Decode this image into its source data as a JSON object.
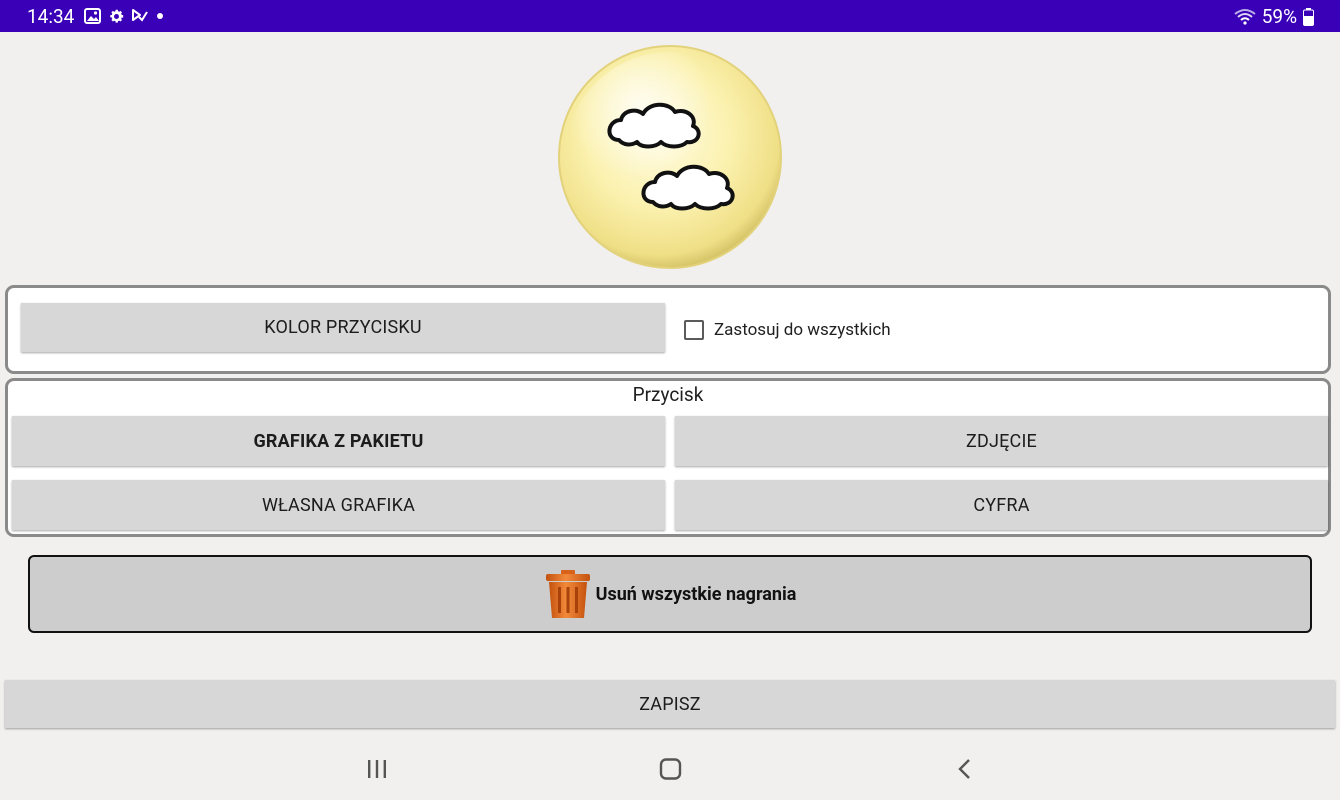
{
  "status_bar": {
    "time": "14:34",
    "battery_percent": "59%",
    "left_icons": [
      "image-icon",
      "gear-icon",
      "download-check-icon",
      "dot-icon"
    ],
    "right_icons": [
      "wifi-icon",
      "battery-icon"
    ],
    "background_color": "#3a00b8"
  },
  "preview": {
    "icon": "sun-cloud-icon"
  },
  "color_panel": {
    "color_button_label": "KOLOR PRZYCISKU",
    "apply_all_label": "Zastosuj do wszystkich",
    "apply_all_checked": false
  },
  "button_panel": {
    "title": "Przycisk",
    "package_graphic_label": "GRAFIKA Z PAKIETU",
    "photo_label": "ZDJĘCIE",
    "own_graphic_label": "WŁASNA GRAFIKA",
    "digit_label": "CYFRA"
  },
  "delete_recordings": {
    "label": "Usuń wszystkie nagrania",
    "icon": "trash-icon",
    "icon_color": "#e8711f"
  },
  "save": {
    "label": "ZAPISZ"
  },
  "nav_bar": {
    "icons": [
      "recent-apps-icon",
      "home-icon",
      "back-icon"
    ]
  }
}
